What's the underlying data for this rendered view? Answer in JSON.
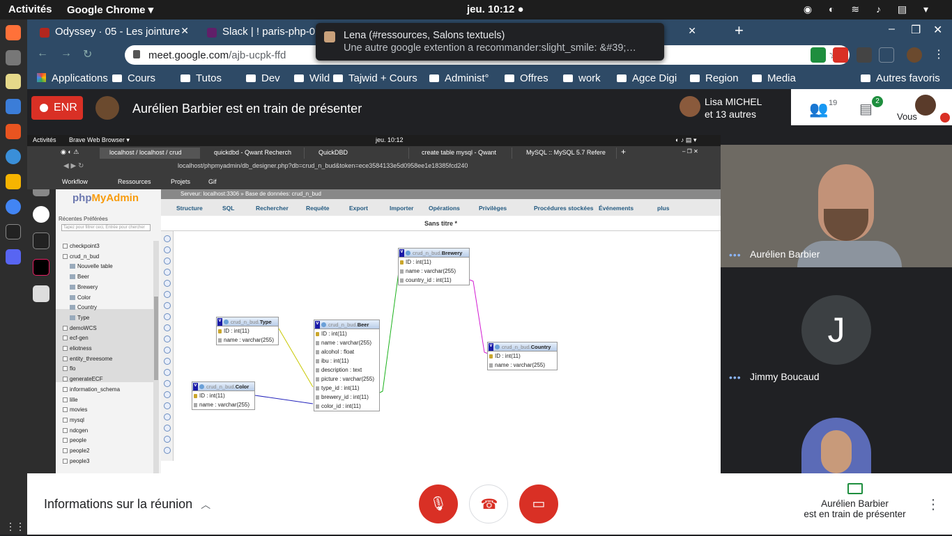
{
  "os": {
    "activities": "Activités",
    "app": "Google Chrome ▾",
    "clock": "jeu. 10:12 ●"
  },
  "chrome": {
    "tabs": [
      {
        "label": "Odyssey · 05 - Les jointure",
        "fav": "#b3261e"
      },
      {
        "label": "Slack | ! paris-php-0",
        "fav": "#611f69"
      }
    ],
    "url_domain": "meet.google.com",
    "url_path": "/ajb-ucpk-ffd",
    "bookmarks": [
      "Applications",
      "Cours",
      "Tutos",
      "Dev",
      "Wild",
      "Tajwid + Cours",
      "Administ°",
      "Offres",
      "work",
      "Agce Digi",
      "Region",
      "Media"
    ],
    "other_bookmarks": "Autres favoris"
  },
  "notification": {
    "title": "Lena (#ressources, Salons textuels)",
    "body": "Une autre google extention a recommander:slight_smile:   &#39;…"
  },
  "meet": {
    "rec_label": "ENR",
    "presenting_text": "Aurélien Barbier est en train de présenter",
    "participant_name": "Lisa MICHEL",
    "participant_more": "et 13 autres",
    "people_count": "19",
    "chat_count": "2",
    "you_label": "Vous",
    "tiles": [
      {
        "name": "Aurélien Barbier"
      },
      {
        "name": "Jimmy Boucaud",
        "initial": "J"
      }
    ],
    "meeting_info": "Informations sur la réunion",
    "presenter_box_line1": "Aurélien Barbier",
    "presenter_box_line2": "est en train de présenter"
  },
  "shared": {
    "ubar_activities": "Activités",
    "ubar_app": "Brave Web Browser ▾",
    "ubar_clock": "jeu. 10:12",
    "browser_tabs": [
      "localhost / localhost / crud",
      "quickdbd - Qwant Recherch",
      "QuickDBD",
      "create table mysql - Qwant",
      "MySQL :: MySQL 5.7 Refere"
    ],
    "url": "localhost/phpmyadmin/db_designer.php?db=crud_n_bud&token=ece3584133e5d0958ee1e18385fcd240",
    "bookmarks": [
      "Workflow",
      "Ressources",
      "Projets",
      "Gif"
    ],
    "pma_logo_a": "php",
    "pma_logo_b": "MyAdmin",
    "pma_tabs": "Récentes   Préférées",
    "filter_placeholder": "Tapez pour filtrer ceci, Entrée pour chercher",
    "tree": [
      "checkpoint3",
      "crud_n_bud",
      "Nouvelle table",
      "Beer",
      "Brewery",
      "Color",
      "Country",
      "Type",
      "demoWCS",
      "ecf-gen",
      "eliotness",
      "entity_threesome",
      "flo",
      "generateECF",
      "information_schema",
      "lille",
      "movies",
      "mysql",
      "ndcgen",
      "people",
      "people2",
      "people3"
    ],
    "breadcrumb": "Serveur: localhost:3306 » Base de données: crud_n_bud",
    "menu": [
      "Structure",
      "SQL",
      "Rechercher",
      "Requête",
      "Export",
      "Importer",
      "Opérations",
      "Privilèges",
      "Procédures stockées",
      "Événements",
      "plus"
    ],
    "designer_title": "Sans titre *",
    "db_prefix": "crud_n_bud",
    "tables": {
      "type": {
        "name": "Type",
        "cols": [
          "ID : int(11)",
          "name : varchar(255)"
        ]
      },
      "color": {
        "name": "Color",
        "cols": [
          "ID : int(11)",
          "name : varchar(255)"
        ]
      },
      "beer": {
        "name": "Beer",
        "cols": [
          "ID : int(11)",
          "name : varchar(255)",
          "alcohol : float",
          "ibu : int(11)",
          "description : text",
          "picture : varchar(255)",
          "type_id : int(11)",
          "brewery_id : int(11)",
          "color_id : int(11)"
        ]
      },
      "brewery": {
        "name": "Brewery",
        "cols": [
          "ID : int(11)",
          "name : varchar(255)",
          "country_id : int(11)"
        ]
      },
      "country": {
        "name": "Country",
        "cols": [
          "ID : int(11)",
          "name : varchar(255)"
        ]
      }
    }
  }
}
